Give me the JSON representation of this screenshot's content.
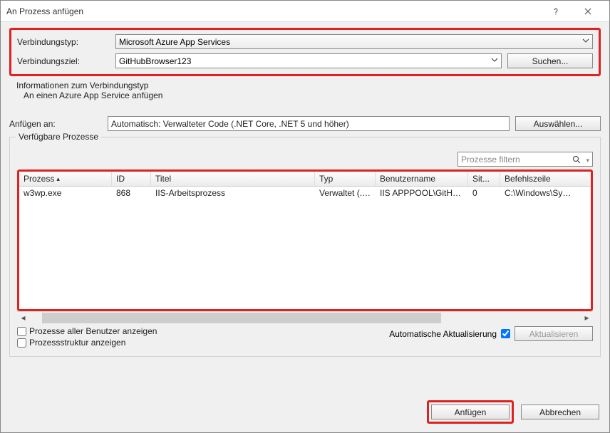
{
  "window": {
    "title": "An Prozess anfügen"
  },
  "connection": {
    "type_label": "Verbindungstyp:",
    "type_value": "Microsoft Azure App Services",
    "target_label": "Verbindungsziel:",
    "target_value": "GitHubBrowser123",
    "search_btn": "Suchen..."
  },
  "info": {
    "heading": "Informationen zum Verbindungstyp",
    "line1": "An einen Azure App Service anfügen"
  },
  "attach": {
    "label": "Anfügen an:",
    "value": "Automatisch: Verwalteter Code (.NET Core, .NET 5 und höher)",
    "select_btn": "Auswählen..."
  },
  "processes": {
    "legend": "Verfügbare Prozesse",
    "filter_placeholder": "Prozesse filtern",
    "columns": {
      "process": "Prozess",
      "id": "ID",
      "title": "Titel",
      "type": "Typ",
      "user": "Benutzername",
      "session": "Sit...",
      "cmdline": "Befehlszeile"
    },
    "rows": [
      {
        "process": "w3wp.exe",
        "id": "868",
        "title": "IIS-Arbeitsprozess",
        "type": "Verwaltet (.N...",
        "user": "IIS APPPOOL\\GitHub...",
        "session": "0",
        "cmdline": "C:\\Windows\\SysW"
      }
    ]
  },
  "options": {
    "all_users": "Prozesse aller Benutzer anzeigen",
    "tree": "Prozessstruktur anzeigen",
    "auto_refresh": "Automatische Aktualisierung",
    "refresh_btn": "Aktualisieren"
  },
  "buttons": {
    "attach": "Anfügen",
    "cancel": "Abbrechen"
  }
}
